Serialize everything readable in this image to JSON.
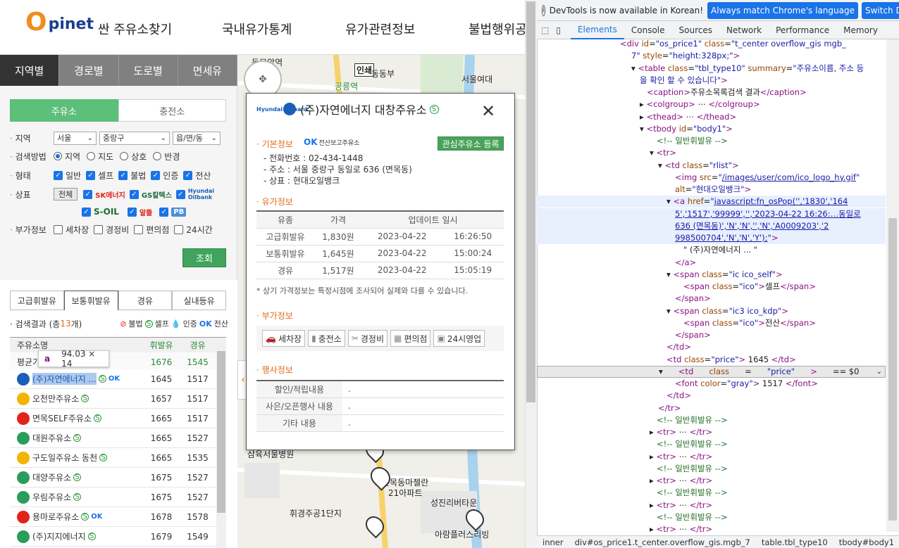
{
  "header": {
    "logo_o": "O",
    "logo_rest": "pinet",
    "nav": [
      "싼 주유소찾기",
      "국내유가통계",
      "유가관련정보",
      "불법행위공"
    ]
  },
  "left_tabs": [
    "지역별",
    "경로별",
    "도로별",
    "면세유"
  ],
  "sub_tabs": [
    "주유소",
    "충전소"
  ],
  "filters": {
    "region_label": "지역",
    "region_values": [
      "서울",
      "중랑구",
      "읍/면/동"
    ],
    "method_label": "검색방법",
    "method_options": [
      "지역",
      "지도",
      "상호",
      "반경"
    ],
    "type_label": "형태",
    "type_options": [
      "일반",
      "셀프",
      "불법",
      "인증",
      "전산"
    ],
    "brand_label": "상표",
    "brand_all": "전체",
    "brand_sk": "SK에너지",
    "brand_gs": "GS칼텍스",
    "brand_hd": "Hyundai Oilbank",
    "brand_soil": "S-OIL",
    "brand_al": "알뜰",
    "brand_pb": "PB",
    "extra_label": "부가정보",
    "extra_options": [
      "세차장",
      "경정비",
      "편의점",
      "24시간"
    ],
    "search_button": "조회"
  },
  "fuel_tabs": [
    "고급휘발유",
    "보통휘발유",
    "경유",
    "실내등유"
  ],
  "result": {
    "prefix": "· 검색결과 (총 ",
    "count": "13",
    "suffix": "개)",
    "legend_illegal": "불법",
    "legend_self": "셀프",
    "legend_cert": "인증",
    "legend_comp": "전산"
  },
  "list": {
    "headers": [
      "주유소명",
      "휘발유",
      "경유"
    ],
    "avg": {
      "name": "평균가",
      "gas": "1676",
      "diesel": "1545"
    },
    "rows": [
      {
        "name": "(주)자연에너지 ...",
        "gas": "1645",
        "diesel": "1517",
        "color": "#1a5eb8"
      },
      {
        "name": "오천만주유소",
        "gas": "1657",
        "diesel": "1517",
        "color": "#f4b400"
      },
      {
        "name": "면목SELF주유소",
        "gas": "1665",
        "diesel": "1517",
        "color": "#e2231a"
      },
      {
        "name": "대원주유소",
        "gas": "1665",
        "diesel": "1527",
        "color": "#2a9d5c"
      },
      {
        "name": "구도일주유소 동천",
        "gas": "1665",
        "diesel": "1535",
        "color": "#f4b400"
      },
      {
        "name": "대양주유소",
        "gas": "1675",
        "diesel": "1527",
        "color": "#2a9d5c"
      },
      {
        "name": "우림주유소",
        "gas": "1675",
        "diesel": "1527",
        "color": "#2a9d5c"
      },
      {
        "name": "용마로주유소",
        "gas": "1678",
        "diesel": "1578",
        "color": "#e2231a"
      },
      {
        "name": "(주)지지에너지",
        "gas": "1679",
        "diesel": "1549",
        "color": "#2a9d5c"
      }
    ]
  },
  "tooltip": {
    "tag": "a",
    "size": "94.03 × 14"
  },
  "map_labels": [
    "동묘앞역",
    "인쇄",
    "동동부",
    "서울여대",
    "공릉역",
    "삼육서울병원",
    "면목동마젤란",
    "21아파트",
    "휘경주공1단지",
    "성진리버타운",
    "아람플러스리빙"
  ],
  "popup": {
    "title": "(주)자연에너지 대창주유소",
    "basic_header": "기본정보",
    "comp_badge": "전산보고주유소",
    "fav_button": "관심주유소 등록",
    "phone": "- 전화번호 : 02-434-1448",
    "address": "- 주소 : 서울 중랑구 동일로 636 (면목동)",
    "brand": "- 상표 : 현대오일뱅크",
    "price_header": "유가정보",
    "price_cols": [
      "유종",
      "가격",
      "업데이트 일시"
    ],
    "prices": [
      {
        "kind": "고급휘발유",
        "price": "1,830원",
        "date": "2023-04-22",
        "time": "16:26:50"
      },
      {
        "kind": "보통휘발유",
        "price": "1,645원",
        "date": "2023-04-22",
        "time": "15:00:24"
      },
      {
        "kind": "경유",
        "price": "1,517원",
        "date": "2023-04-22",
        "time": "15:05:19"
      }
    ],
    "note": "* 상기 가격정보는 특정시점에 조사되어 실제와 다를 수 있습니다.",
    "extra_header": "부가정보",
    "extras": [
      "세차장",
      "충전소",
      "경정비",
      "편의점",
      "24시영업"
    ],
    "event_header": "행사정보",
    "events": [
      {
        "label": "할인/적립내용",
        "value": "."
      },
      {
        "label": "사은/오픈행사 내용",
        "value": "."
      },
      {
        "label": "기타 내용",
        "value": "."
      }
    ]
  },
  "devtools": {
    "banner": "DevTools is now available in Korean!",
    "btn_match": "Always match Chrome's language",
    "btn_switch": "Switch DevTools",
    "tabs": [
      "Elements",
      "Console",
      "Sources",
      "Network",
      "Performance",
      "Memory"
    ],
    "lines": [
      {
        "indent": 118,
        "html": "<span class=\"tg\">&lt;div</span> <span class=\"at\">id</span>=<span class=\"av\">\"os_price1\"</span> <span class=\"at\">class</span>=<span class=\"av\">\"t_center overflow_gis mgb_</span>"
      },
      {
        "indent": 134,
        "html": "<span class=\"av\">7\"</span> <span class=\"at\">style</span>=<span class=\"av\">\"height:328px;\"</span><span class=\"tg\">&gt;</span>"
      },
      {
        "indent": 134,
        "html": "▾ <span class=\"tg\">&lt;table</span> <span class=\"at\">class</span>=<span class=\"av\">\"tbl_type10\"</span> <span class=\"at\">summary</span>=<span class=\"av\">\"주유소이름, 주소 등</span>"
      },
      {
        "indent": 146,
        "html": "<span class=\"av\">을 확인 할 수 있습니다\"</span><span class=\"tg\">&gt;</span>"
      },
      {
        "indent": 156,
        "html": "<span class=\"tg\">&lt;caption&gt;</span>주유소목록검색 결과<span class=\"tg\">&lt;/caption&gt;</span>"
      },
      {
        "indent": 146,
        "html": "▸ <span class=\"tg\">&lt;colgroup&gt;</span> ⋯ <span class=\"tg\">&lt;/colgroup&gt;</span>"
      },
      {
        "indent": 146,
        "html": "▸ <span class=\"tg\">&lt;thead&gt;</span> ⋯ <span class=\"tg\">&lt;/thead&gt;</span>"
      },
      {
        "indent": 146,
        "html": "▾ <span class=\"tg\">&lt;tbody</span> <span class=\"at\">id</span>=<span class=\"av\">\"body1\"</span><span class=\"tg\">&gt;</span>"
      },
      {
        "indent": 170,
        "html": "<span class=\"cm\">&lt;!-- 일반휘발유 --&gt;</span>"
      },
      {
        "indent": 160,
        "html": "▾ <span class=\"tg\">&lt;tr&gt;</span>"
      },
      {
        "indent": 172,
        "html": "▾ <span class=\"tg\">&lt;td</span> <span class=\"at\">class</span>=<span class=\"av\">\"rlist\"</span><span class=\"tg\">&gt;</span>"
      },
      {
        "indent": 196,
        "html": "<span class=\"tg\">&lt;img</span> <span class=\"at\">src</span>=<span class=\"av\">\"<span class=\"ln\">/images/user/com/ico_logo_hy.gif</span>\"</span>"
      },
      {
        "indent": 196,
        "html": "<span class=\"at\">alt</span>=<span class=\"av\">\"현대오일뱅크\"</span><span class=\"tg\">&gt;</span>"
      },
      {
        "indent": 184,
        "html": "▾ <span class=\"tg\">&lt;a</span> <span class=\"at\">href</span>=<span class=\"av\">\"<span class=\"ln\">javascript:fn_osPop('','1830','164</span></span>"
      },
      {
        "indent": 196,
        "html": "<span class=\"ln av\">5','1517','99999','','2023-04-22 16:26:…동일로</span>"
      },
      {
        "indent": 196,
        "html": "<span class=\"ln av\">636 (면목동)','N','N','','N','A0009203','2</span>"
      },
      {
        "indent": 196,
        "html": "<span class=\"ln av\">998500704','N','N','Y');</span><span class=\"av\">\"</span><span class=\"tg\">&gt;</span>"
      },
      {
        "indent": 208,
        "html": "\" (주)자연에너지 ... \""
      },
      {
        "indent": 196,
        "html": "<span class=\"tg\">&lt;/a&gt;</span>"
      },
      {
        "indent": 184,
        "html": "▾ <span class=\"tg\">&lt;span</span> <span class=\"at\">class</span>=<span class=\"av\">\"ic ico_self\"</span><span class=\"tg\">&gt;</span>"
      },
      {
        "indent": 208,
        "html": "<span class=\"tg\">&lt;span</span> <span class=\"at\">class</span>=<span class=\"av\">\"ico\"</span><span class=\"tg\">&gt;</span>셀프<span class=\"tg\">&lt;/span&gt;</span>"
      },
      {
        "indent": 196,
        "html": "<span class=\"tg\">&lt;/span&gt;</span>"
      },
      {
        "indent": 184,
        "html": "▾ <span class=\"tg\">&lt;span</span> <span class=\"at\">class</span>=<span class=\"av\">\"ic3 ico_kdp\"</span><span class=\"tg\">&gt;</span>"
      },
      {
        "indent": 208,
        "html": "<span class=\"tg\">&lt;span</span> <span class=\"at\">class</span>=<span class=\"av\">\"ico\"</span><span class=\"tg\">&gt;</span>전산<span class=\"tg\">&lt;/span&gt;</span>"
      },
      {
        "indent": 196,
        "html": "<span class=\"tg\">&lt;/span&gt;</span>"
      },
      {
        "indent": 184,
        "html": "<span class=\"tg\">&lt;/td&gt;</span>"
      },
      {
        "indent": 184,
        "html": "<span class=\"tg\">&lt;td</span> <span class=\"at\">class</span>=<span class=\"av\">\"price\"</span><span class=\"tg\">&gt;</span> 1645 <span class=\"tg\">&lt;/td&gt;</span>"
      },
      {
        "indent": 172,
        "html": "▾ <span class=\"tg\">&lt;td</span> <span class=\"at\">class</span>=<span class=\"av\">\"price\"</span><span class=\"tg\">&gt;</span> == $0"
      },
      {
        "indent": 196,
        "html": "<span class=\"tg\">&lt;font</span> <span class=\"at\">color</span>=<span class=\"av\">\"gray\"</span><span class=\"tg\">&gt;</span> 1517 <span class=\"tg\">&lt;/font&gt;</span>"
      },
      {
        "indent": 184,
        "html": "<span class=\"tg\">&lt;/td&gt;</span>"
      },
      {
        "indent": 172,
        "html": "<span class=\"tg\">&lt;/tr&gt;</span>"
      },
      {
        "indent": 170,
        "html": "<span class=\"cm\">&lt;!-- 일반휘발유 --&gt;</span>"
      },
      {
        "indent": 160,
        "html": "▸ <span class=\"tg\">&lt;tr&gt;</span> ⋯ <span class=\"tg\">&lt;/tr&gt;</span>"
      },
      {
        "indent": 170,
        "html": "<span class=\"cm\">&lt;!-- 일반휘발유 --&gt;</span>"
      },
      {
        "indent": 160,
        "html": "▸ <span class=\"tg\">&lt;tr&gt;</span> ⋯ <span class=\"tg\">&lt;/tr&gt;</span>"
      },
      {
        "indent": 170,
        "html": "<span class=\"cm\">&lt;!-- 일반휘발유 --&gt;</span>"
      },
      {
        "indent": 160,
        "html": "▸ <span class=\"tg\">&lt;tr&gt;</span> ⋯ <span class=\"tg\">&lt;/tr&gt;</span>"
      },
      {
        "indent": 170,
        "html": "<span class=\"cm\">&lt;!-- 일반휘발유 --&gt;</span>"
      },
      {
        "indent": 160,
        "html": "▸ <span class=\"tg\">&lt;tr&gt;</span> ⋯ <span class=\"tg\">&lt;/tr&gt;</span>"
      },
      {
        "indent": 170,
        "html": "<span class=\"cm\">&lt;!-- 일반휘발유 --&gt;</span>"
      },
      {
        "indent": 160,
        "html": "▸ <span class=\"tg\">&lt;tr&gt;</span> ⋯ <span class=\"tg\">&lt;/tr&gt;</span>"
      }
    ],
    "crumbs": [
      "inner",
      "div#os_price1.t_center.overflow_gis.mgb_7",
      "table.tbl_type10",
      "tbody#body1"
    ]
  }
}
